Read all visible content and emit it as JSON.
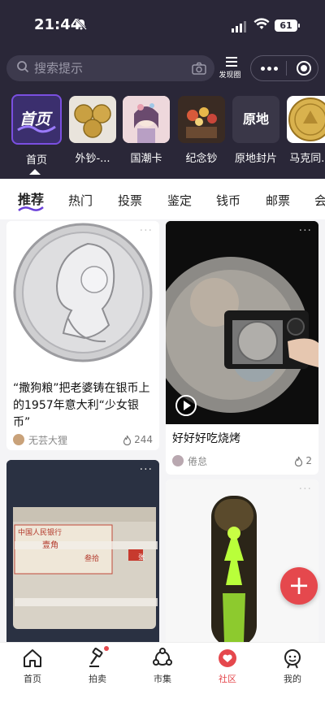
{
  "status": {
    "time": "21:44",
    "battery": "61"
  },
  "search": {
    "placeholder": "搜索提示",
    "discover_label": "发现圈"
  },
  "categories": [
    {
      "label": "首页",
      "badge_text": "首页",
      "active": true
    },
    {
      "label": "外钞-..."
    },
    {
      "label": "国潮卡"
    },
    {
      "label": "纪念钞"
    },
    {
      "label": "原地封片",
      "badge_text": "原地"
    },
    {
      "label": "马克同..."
    }
  ],
  "tabs": [
    "推荐",
    "热门",
    "投票",
    "鉴定",
    "钱币",
    "邮票",
    "会"
  ],
  "active_tab": "推荐",
  "posts": [
    {
      "title": "“撒狗粮”把老婆铸在银币上的1957年意大利“少女银币”",
      "author": "无芸大狸",
      "heat": "244"
    },
    {
      "title": "好好好吃烧烤",
      "author": "倦怠",
      "heat": "2",
      "has_video": true
    },
    {
      "image_text": [
        "中国人民银行",
        "壹角",
        "叁拾",
        "张"
      ]
    },
    {}
  ],
  "fab_icon": "plus-icon",
  "bottom_nav": [
    {
      "label": "首页",
      "icon": "home-icon"
    },
    {
      "label": "拍卖",
      "icon": "gavel-icon",
      "has_dot": true
    },
    {
      "label": "市集",
      "icon": "market-icon"
    },
    {
      "label": "社区",
      "icon": "heart-icon",
      "active": true
    },
    {
      "label": "我的",
      "icon": "profile-icon"
    }
  ],
  "colors": {
    "header_bg": "#2a2738",
    "accent": "#e5484d",
    "active_purple": "#7a4fe0"
  }
}
